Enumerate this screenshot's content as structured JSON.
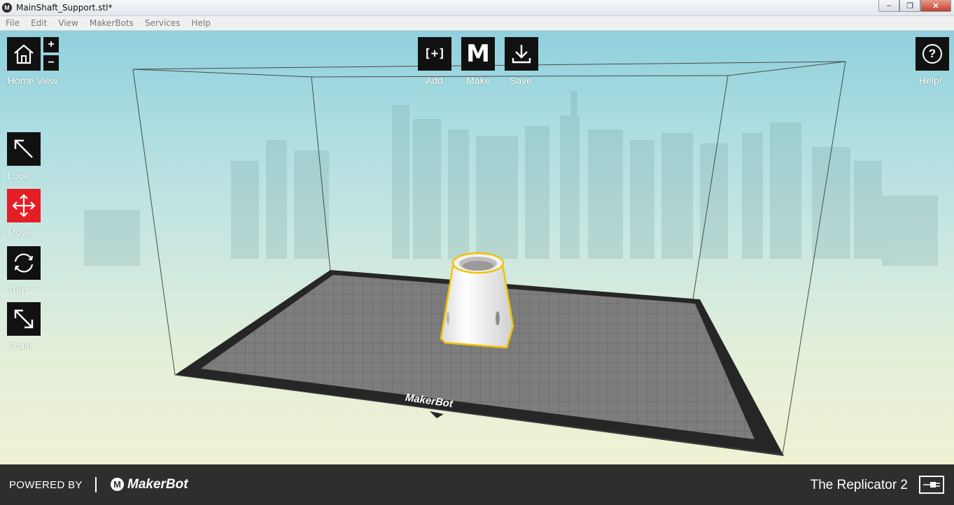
{
  "window": {
    "title": "MainShaft_Support.stl*",
    "app_icon": "makerbot-logo-icon"
  },
  "menubar": {
    "items": [
      {
        "label": "File"
      },
      {
        "label": "Edit"
      },
      {
        "label": "View"
      },
      {
        "label": "MakerBots"
      },
      {
        "label": "Services"
      },
      {
        "label": "Help"
      }
    ]
  },
  "toolbar": {
    "home_view_label": "Home View",
    "zoom_in": "+",
    "zoom_out": "−",
    "add_label": "Add",
    "add_glyph": "[+]",
    "make_label": "Make",
    "make_glyph": "M",
    "save_label": "Save",
    "help_label": "Help!",
    "help_glyph": "?"
  },
  "tools": {
    "look_label": "Look",
    "move_label": "Move",
    "turn_label": "Turn",
    "scale_label": "Scale",
    "active_tool": "Move"
  },
  "scene": {
    "platform_brand": "MakerBot",
    "model": "MainShaft_Support.stl"
  },
  "footer": {
    "powered_by": "POWERED BY",
    "brand": "MakerBot",
    "machine": "The Replicator 2",
    "connection_icon": "usb-connection-icon"
  },
  "colors": {
    "accent_active": "#e41e25",
    "button_bg": "#111111",
    "footer_bg": "#2e2e2e",
    "selection_outline": "#f2c200"
  }
}
